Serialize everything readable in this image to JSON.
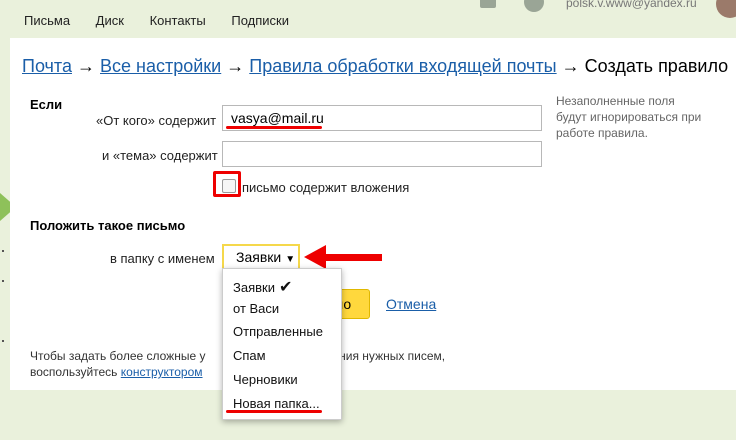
{
  "topbar": {
    "nav": [
      "Письма",
      "Диск",
      "Контакты",
      "Подписки"
    ],
    "user": "polsk.v.www@yandex.ru"
  },
  "breadcrumb": {
    "mail": "Почта",
    "all_settings": "Все настройки",
    "rules": "Правила обработки входящей почты",
    "current": "Создать правило",
    "sep": "→"
  },
  "form": {
    "if_label": "Если",
    "from_label": "«От кого» содержит",
    "from_value": "vasya@mail.ru",
    "subject_label": "и «тема» содержит",
    "subject_value": "",
    "attachments_label": "письмо содержит вложения",
    "attachments_checked": false,
    "hint": "Незаполненные поля будут игнорироваться при работе правила.",
    "put_label": "Положить такое письмо",
    "folder_label": "в папку с именем",
    "folder_selected": "Заявки",
    "save_label": "ло",
    "cancel_label": "Отмена",
    "bottom_text_1a": "Чтобы задать более сложные у",
    "bottom_text_1b": "ления нужных писем,",
    "bottom_text_2a": "воспользуйтесь ",
    "bottom_link": "конструктором"
  },
  "dropdown": {
    "items": [
      "Заявки",
      "от Васи",
      "Отправленные",
      "Спам",
      "Черновики",
      "Новая папка..."
    ],
    "selected_index": 0
  },
  "colors": {
    "link": "#1a5ea8",
    "accent_red": "#e00000",
    "button_yellow": "#ffd83d",
    "background": "#eaf1dc"
  }
}
